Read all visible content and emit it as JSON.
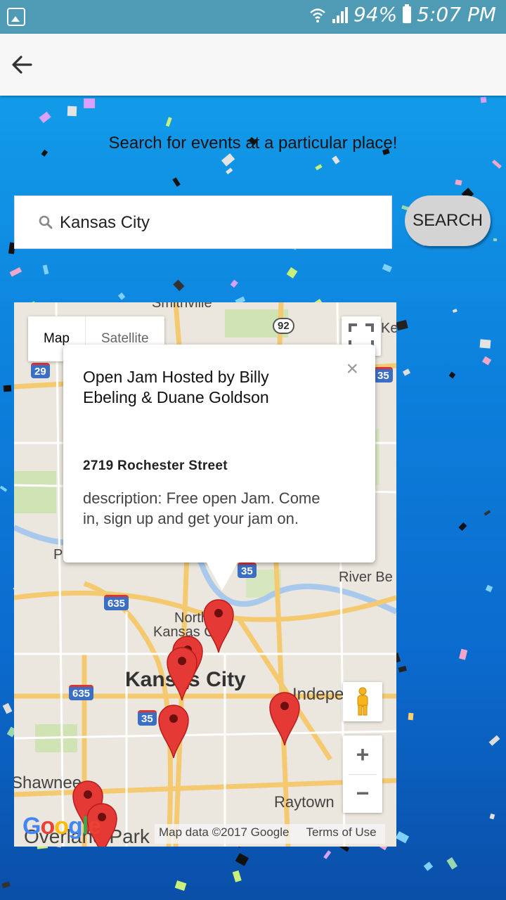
{
  "status_bar": {
    "battery": "94%",
    "time": "5:07 PM"
  },
  "app_bar": {
    "back_icon": "arrow-back-icon"
  },
  "page": {
    "headline": "Search for events at a particular place!"
  },
  "search": {
    "value": "Kansas City",
    "button_label": "SEARCH",
    "icon": "search-icon"
  },
  "map": {
    "type_controls": [
      {
        "label": "Map",
        "active": true
      },
      {
        "label": "Satellite",
        "active": false
      }
    ],
    "labels": {
      "smithville": "Smithville",
      "kearney": "Ke",
      "north_kansas_city_1": "North",
      "north_kansas_city_2": "Kansas City",
      "kansas_city": "Kansas City",
      "independence": "Independen",
      "river_bend": "River Be",
      "shawnee": "Shawnee",
      "raytown": "Raytown",
      "overland_park": "Overland Park",
      "parkville": "P"
    },
    "highways": {
      "h92": "92",
      "h29": "29",
      "h35a": "35",
      "h35b": "35",
      "h35c": "35",
      "h635a": "635",
      "h635b": "635"
    },
    "info_window": {
      "title": "Open Jam Hosted by Billy Ebeling & Duane Goldson",
      "address": "2719 Rochester Street",
      "description": "description: Free open Jam. Come in, sign up and get your jam on.",
      "close": "×"
    },
    "zoom_in": "+",
    "zoom_out": "−",
    "google_logo": "Google",
    "map_data": "Map data ©2017 Google",
    "terms": "Terms of Use",
    "marker_color": "#e53935"
  },
  "colors": {
    "status_bar": "#4f9bb5",
    "background_top": "#129be9",
    "background_bottom": "#0a4fa8"
  }
}
